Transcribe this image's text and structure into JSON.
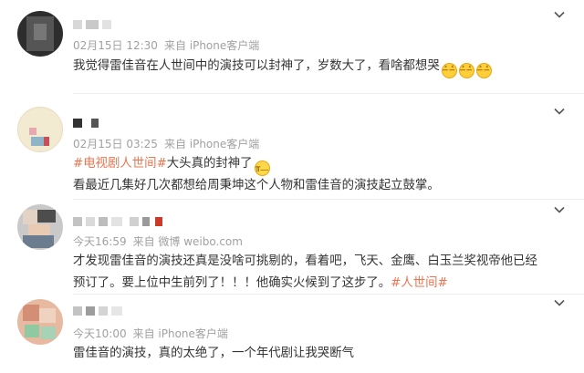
{
  "comments": [
    {
      "time": "02月15日 12:30",
      "source": "来自 iPhone客户端",
      "text": "我觉得雷佳音在人世间中的演技可以封神了，岁数大了，看啥都想哭",
      "emojis": [
        "😂",
        "😂",
        "😂"
      ]
    },
    {
      "time": "02月15日 03:25",
      "source": "来自 iPhone客户端",
      "hashtag": "#电视剧人世间#",
      "text_after_hashtag": "大头真的封神了",
      "emoji": "😭",
      "text2": "看最近几集好几次都想给周秉坤这个人物和雷佳音的演技起立鼓掌。"
    },
    {
      "time": "今天16:59",
      "source": "来自 微博 weibo.com",
      "text_line1": "才发现雷佳音的演技还真是没啥可挑剔的，看着吧，飞天、金鹰、白玉兰奖视帝他已经",
      "text_line2": "预订了。要上位中生前列了！！！他确实火候到了这步了。",
      "hashtag": "#人世间#"
    },
    {
      "time": "今天10:00",
      "source": "来自 iPhone客户端",
      "text": "雷佳音的演技，真的太绝了，一个年代剧让我哭断气"
    }
  ],
  "icons": {
    "expand": "chevron-down-icon",
    "emoji_laugh": "laugh-cry-emoji",
    "emoji_cry": "crying-emoji"
  },
  "colors": {
    "hashtag": "#eb7350",
    "meta": "#a1a1a1",
    "text": "#333333"
  }
}
